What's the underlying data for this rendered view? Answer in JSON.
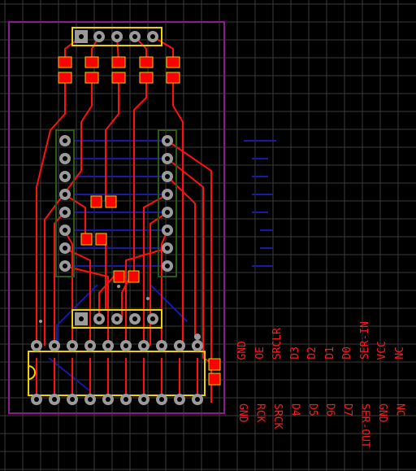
{
  "colors": {
    "background": "#000000",
    "grid": "#3a3a3a",
    "board_outline": "#8b1a8b",
    "trace_top": "#ff1010",
    "trace_bottom": "#1a1aa0",
    "silkscreen": "#f2d000",
    "pad": "#9a9a9a",
    "smd_pad": "#ff0000",
    "header_outline": "#2a5a1a"
  },
  "pin_labels_top": [
    "GND",
    "OE",
    "SRCLR",
    "D3",
    "D2",
    "D1",
    "D0",
    "SER-IN",
    "VCC",
    "NC"
  ],
  "pin_labels_bottom": [
    "GND",
    "RCK",
    "SRCK",
    "D4",
    "D5",
    "D6",
    "D7",
    "SER-OUT",
    "GND",
    "NC"
  ]
}
